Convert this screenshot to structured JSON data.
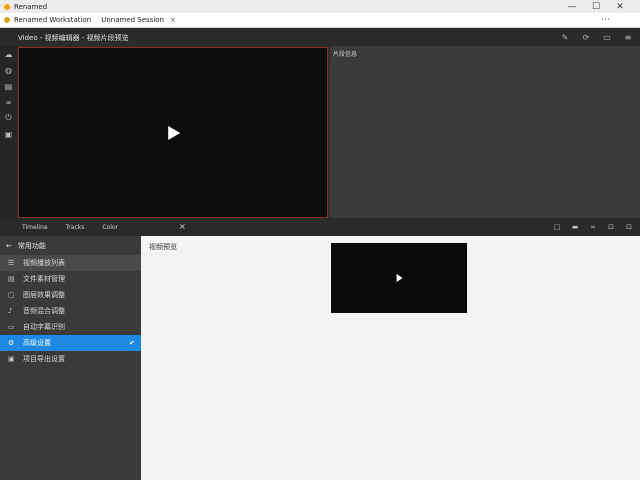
{
  "window": {
    "title": "Renamed",
    "controls": {
      "minimize": "—",
      "maximize": "☐",
      "close": "✕"
    }
  },
  "tabs": [
    {
      "label": "Renamed Workstation",
      "icon": "app-icon"
    },
    {
      "label": "Unnamed Session",
      "icon": "globe-icon",
      "close": "×"
    }
  ],
  "tabbar": {
    "menu": "⋯"
  },
  "editor": {
    "title": "Video - 视频编辑器 - 视频片段预览",
    "panel_label": "片段信息",
    "bottom_labels": [
      "Timeline",
      "Tracks",
      "Color"
    ],
    "bottom_close": "×"
  },
  "sidebar": {
    "header": "常用功能",
    "items": [
      {
        "label": "视频播放列表",
        "icon": "list-icon",
        "state": "hover"
      },
      {
        "label": "文件素材管理",
        "icon": "file-icon",
        "state": ""
      },
      {
        "label": "图层效果调整",
        "icon": "layers-icon",
        "state": ""
      },
      {
        "label": "音频混合调整",
        "icon": "audio-icon",
        "state": ""
      },
      {
        "label": "自动字幕识别",
        "icon": "caption-icon",
        "state": ""
      },
      {
        "label": "高级设置",
        "icon": "settings-icon",
        "state": "active"
      },
      {
        "label": "项目导出设置",
        "icon": "export-icon",
        "state": ""
      }
    ]
  },
  "content": {
    "heading": "视频预览"
  },
  "colors": {
    "accent": "#1e88e5",
    "editor_bg": "#2d2d2d",
    "preview_border": "#8a2a2a"
  }
}
